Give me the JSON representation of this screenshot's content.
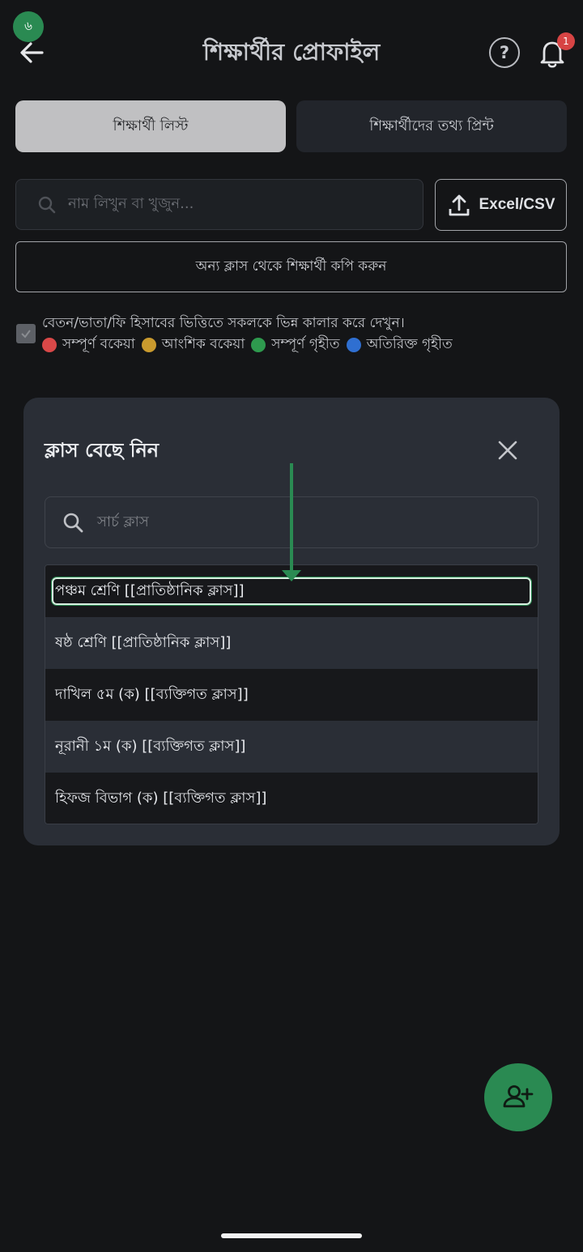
{
  "status": {
    "badge": "৬"
  },
  "header": {
    "title": "শিক্ষার্থীর প্রোফাইল",
    "help_icon": "?",
    "notification_count": "1"
  },
  "tabs": [
    {
      "label": "শিক্ষার্থী লিস্ট",
      "active": true
    },
    {
      "label": "শিক্ষার্থীদের তথ্য প্রিন্ট",
      "active": false
    }
  ],
  "search": {
    "placeholder": "নাম লিখুন বা খুজুন..."
  },
  "upload": {
    "label": "Excel/CSV"
  },
  "copy_button": {
    "label": "অন্য ক্লাস থেকে শিক্ষার্থী কপি করুন"
  },
  "legend": {
    "checkbox_label": "বেতন/ভাতা/ফি হিসাবের ভিত্তিতে সকলকে ভিন্ন কালার করে দেখুন।",
    "items": [
      {
        "label": "সম্পূর্ণ বকেয়া",
        "color": "#d94848"
      },
      {
        "label": "আংশিক বকেয়া",
        "color": "#c99a2e"
      },
      {
        "label": "সম্পূর্ণ গৃহীত",
        "color": "#2e9a4e"
      },
      {
        "label": "অতিরিক্ত গৃহীত",
        "color": "#2f6fd1"
      }
    ]
  },
  "modal": {
    "title": "ক্লাস বেছে নিন",
    "search_placeholder": "সার্চ ক্লাস",
    "classes": [
      {
        "label": "পঞ্চম শ্রেণি [[প্রাতিষ্ঠানিক ক্লাস]]",
        "selected": true
      },
      {
        "label": "ষষ্ঠ শ্রেণি [[প্রাতিষ্ঠানিক ক্লাস]]",
        "selected": false
      },
      {
        "label": "দাখিল ৫ম (ক) [[ব্যক্তিগত ক্লাস]]",
        "selected": false
      },
      {
        "label": "নূরানী ১ম (ক) [[ব্যক্তিগত ক্লাস]]",
        "selected": false
      },
      {
        "label": "হিফজ বিভাগ (ক) [[ব্যক্তিগত ক্লাস]]",
        "selected": false
      }
    ]
  },
  "colors": {
    "accent": "#2a8a52",
    "background": "#141517",
    "modal": "#2a2e36"
  },
  "fab": {
    "icon": "add-person-icon"
  }
}
